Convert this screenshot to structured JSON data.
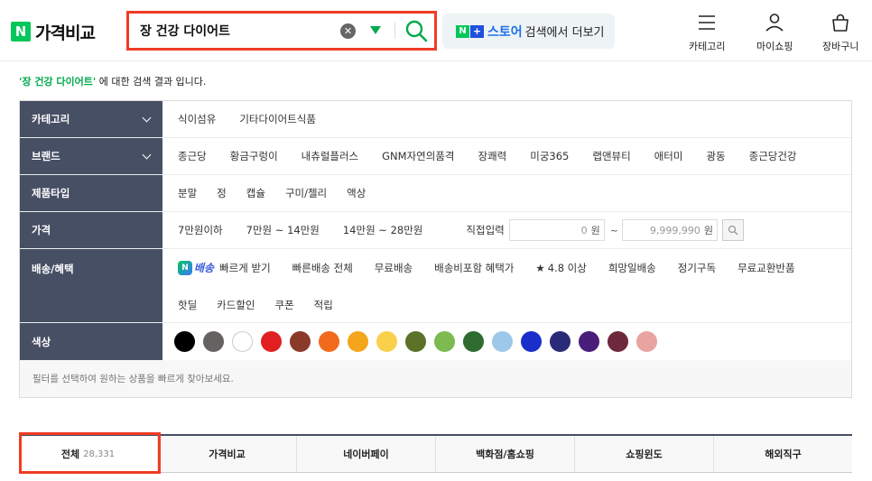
{
  "header": {
    "logo_mark": "N",
    "logo_text": "가격비교",
    "search": {
      "value": "장 건강 다이어트",
      "clear_glyph": "✕"
    },
    "store_button": {
      "n_mark": "N",
      "plus_mark": "+",
      "store_word": "스토어",
      "rest": "검색에서 더보기"
    },
    "menus": [
      {
        "label": "카테고리",
        "icon": "hamburger-icon"
      },
      {
        "label": "마이쇼핑",
        "icon": "user-icon"
      },
      {
        "label": "장바구니",
        "icon": "cart-icon"
      }
    ]
  },
  "result": {
    "keyword": "'장 건강 다이어트'",
    "suffix": "에 대한 검색 결과 입니다."
  },
  "filters": {
    "category": {
      "label": "카테고리",
      "options": [
        "식이섬유",
        "기타다이어트식품"
      ]
    },
    "brand": {
      "label": "브랜드",
      "options": [
        "종근당",
        "황금구렁이",
        "내츄럴플러스",
        "GNM자연의품격",
        "장쾌력",
        "미궁365",
        "랩앤뷰티",
        "애터미",
        "광동",
        "종근당건강"
      ]
    },
    "product_type": {
      "label": "제품타입",
      "options": [
        "분말",
        "정",
        "캡슐",
        "구미/젤리",
        "액상"
      ]
    },
    "price": {
      "label": "가격",
      "options": [
        "7만원이하",
        "7만원 ~ 14만원",
        "14만원 ~ 28만원"
      ],
      "direct_label": "직접입력",
      "min_value": "0",
      "max_value": "9,999,990",
      "unit": "원",
      "tilde": "~"
    },
    "delivery": {
      "label": "배송/혜택",
      "badge_mark": "N",
      "badge_word": "배송",
      "badge_rest": "빠르게 받기",
      "options_line1": [
        "빠른배송 전체",
        "무료배송",
        "배송비포함 혜택가"
      ],
      "star_glyph": "★",
      "star_option": "4.8 이상",
      "options_line1_tail": [
        "희망일배송",
        "정기구독",
        "무료교환반품"
      ],
      "options_line2": [
        "핫딜",
        "카드할인",
        "쿠폰",
        "적립"
      ]
    },
    "color": {
      "label": "색상",
      "swatches": [
        "#000000",
        "#666262",
        "#ffffff",
        "#e02020",
        "#8b3a2a",
        "#f26a1b",
        "#f5a51c",
        "#f9d04b",
        "#5b7228",
        "#7dba50",
        "#2e6b2f",
        "#9dc8ea",
        "#1a2fc9",
        "#2b2a78",
        "#4b1d7a",
        "#6e2a3c",
        "#e9a3a0"
      ]
    },
    "hint": "필터를 선택하여 원하는 상품을 빠르게 찾아보세요."
  },
  "tabs": [
    {
      "label": "전체",
      "count": "28,331"
    },
    {
      "label": "가격비교"
    },
    {
      "label": "네이버페이"
    },
    {
      "label": "백화점/홈쇼핑"
    },
    {
      "label": "쇼핑윈도"
    },
    {
      "label": "해외직구"
    }
  ]
}
